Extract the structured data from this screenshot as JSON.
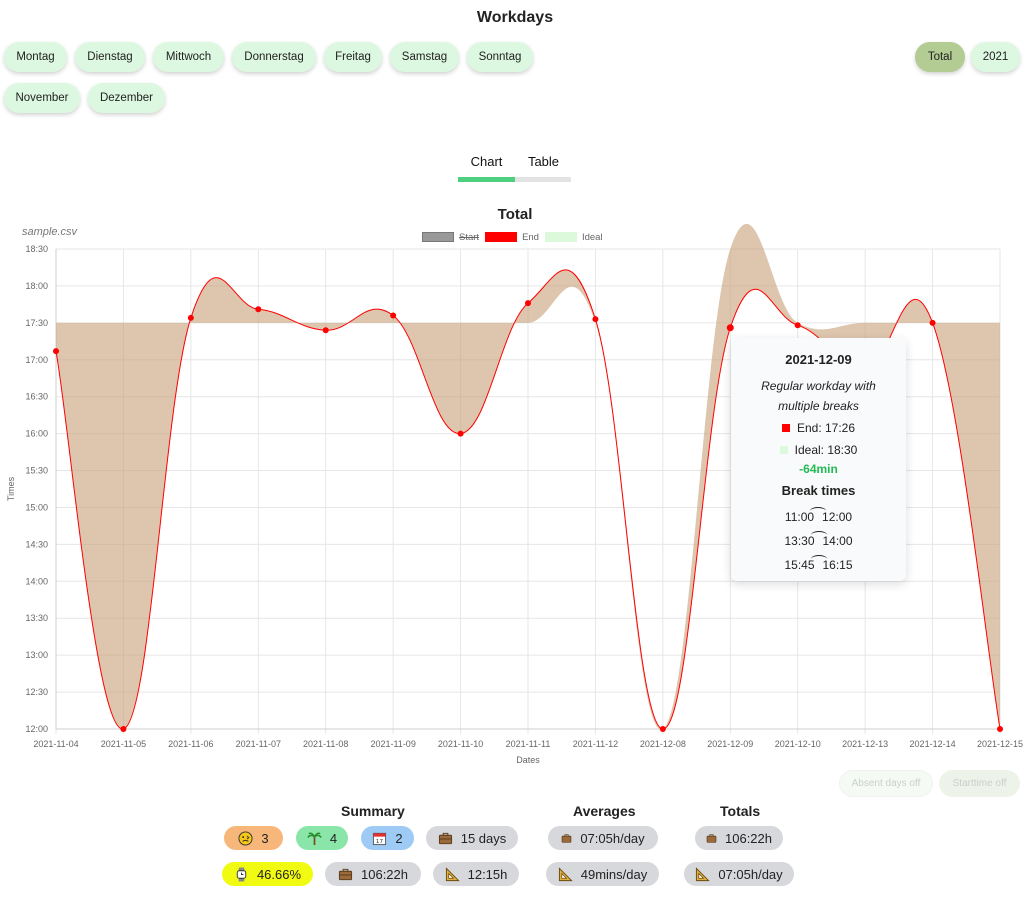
{
  "header": {
    "title": "Workdays"
  },
  "filters": {
    "days": [
      "Montag",
      "Dienstag",
      "Mittwoch",
      "Donnerstag",
      "Freitag",
      "Samstag",
      "Sonntag"
    ],
    "months": [
      "November",
      "Dezember"
    ],
    "scope": [
      "Total",
      "2021"
    ],
    "active": "Total"
  },
  "tabs": {
    "chart": "Chart",
    "table": "Table",
    "active": "Chart"
  },
  "chart": {
    "file_label": "sample.csv",
    "legend": {
      "start": "Start",
      "end": "End",
      "ideal": "Ideal"
    },
    "tooltip": {
      "date": "2021-12-09",
      "description": "Regular workday with multiple breaks",
      "end": "End: 17:26",
      "ideal": "Ideal: 18:30",
      "diff": "-64min",
      "break_title": "Break times",
      "breaks": [
        {
          "from": "11:00",
          "to": "12:00"
        },
        {
          "from": "13:30",
          "to": "14:00"
        },
        {
          "from": "15:45",
          "to": "16:15"
        }
      ]
    }
  },
  "chart_data": {
    "type": "line",
    "title": "Total",
    "xlabel": "Dates",
    "ylabel": "Times",
    "x": [
      "2021-11-04",
      "2021-11-05",
      "2021-11-06",
      "2021-11-07",
      "2021-11-08",
      "2021-11-09",
      "2021-11-10",
      "2021-11-11",
      "2021-11-12",
      "2021-12-08",
      "2021-12-09",
      "2021-12-10",
      "2021-12-13",
      "2021-12-14",
      "2021-12-15"
    ],
    "y_ticks": [
      "12:00",
      "12:30",
      "13:00",
      "13:30",
      "14:00",
      "14:30",
      "15:00",
      "15:30",
      "16:00",
      "16:30",
      "17:00",
      "17:30",
      "18:00",
      "18:30"
    ],
    "ylim": [
      "12:00",
      "18:30"
    ],
    "series": [
      {
        "name": "Start",
        "hidden": true,
        "color": "#999999",
        "values": []
      },
      {
        "name": "End",
        "color": "#ff0000",
        "values": [
          "17:07",
          "12:00",
          "17:34",
          "17:41",
          "17:24",
          "17:36",
          "16:00",
          "17:46",
          "17:33",
          "12:00",
          "17:26",
          "17:28",
          "16:53",
          "17:30",
          "12:00"
        ]
      },
      {
        "name": "Ideal",
        "color": "#dcf9dc",
        "values": [
          "17:30",
          "17:30",
          "17:30",
          "17:30",
          "17:30",
          "17:30",
          "17:30",
          "17:30",
          "17:30",
          "12:00",
          "18:30",
          "17:30",
          "17:30",
          "17:30",
          "17:30"
        ]
      }
    ],
    "grid": true,
    "legend_position": "top-center"
  },
  "toggles": {
    "absent": "Absent days off",
    "starttime": "Starttime off"
  },
  "summary": {
    "title": "Summary",
    "sick": "3",
    "vacation": "4",
    "holidays": "2",
    "work_days": "15 days",
    "percentage": "46.66%",
    "total_hours": "106:22h",
    "overtime": "12:15h"
  },
  "averages": {
    "title": "Averages",
    "per_day": "07:05h/day",
    "break": "49mins/day"
  },
  "totals": {
    "title": "Totals",
    "hours": "106:22h",
    "per_day": "07:05h/day"
  },
  "colors": {
    "pill": "#dcf8e0",
    "pill_active": "#b2cc93",
    "tab_active": "#4cd080",
    "tab_inactive": "#e3e3e3",
    "end_line": "#ff0000",
    "ideal_fill": "#c8f0c8",
    "diff_good": "#22bb55",
    "sick_badge": "#f7b77a",
    "vacation_badge": "#8ae6a8",
    "holiday_badge": "#9ecbf5",
    "percent_badge": "#f1fb11"
  }
}
